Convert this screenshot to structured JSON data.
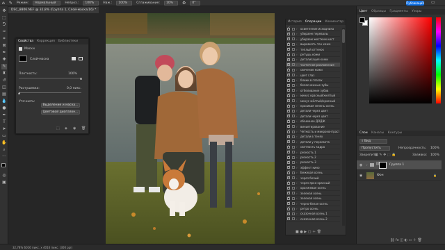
{
  "options_bar": {
    "mode_label": "Режим:",
    "mode_value": "Нормальный",
    "opacity_label": "Непроз.:",
    "opacity_value": "100%",
    "pressure_label": "Наж.:",
    "pressure_value": "100%",
    "smoothing_label": "Сглаживание:",
    "smoothing_value": "10%",
    "angle_value": "0°",
    "publish_label": "Публикация"
  },
  "document_tab": "DSC_8806.NEF @ 32,8% (Группа 1, Слой-маска/16) *",
  "status_bar": "32,78%   6016 пикс. x 4016 пикс. (300 ppi)",
  "properties_panel": {
    "tabs": [
      "Свойства",
      "Коррекция",
      "Библиотеки"
    ],
    "section_label": "Маски",
    "mask_name": "Слой-маска",
    "density_label": "Плотность:",
    "density_value": "100%",
    "feather_label": "Растушевка:",
    "feather_value": "0,0 пикс.",
    "refine_label": "Уточнить:",
    "select_mask_button": "Выделение и маска...",
    "color_range_button": "Цветовой диапазон..."
  },
  "history_panel": {
    "tabs": [
      "История",
      "Операции",
      "Комментар"
    ],
    "items": [
      "осветление исходника",
      "убираем перевалы",
      "убираем жестким кист",
      "выровнять тон коже",
      "теплый оттенок",
      "ретушь кожи",
      "детализация кожи",
      "частотное разложение",
      "свечение кожи",
      "цвет глаз",
      "блики в глазах",
      "белоснежные зубы",
      "отбеливание зубов",
      "минус красный/желтый",
      "минус жёлтый/красный",
      "красивая зелень осень",
      "детали через цвет",
      "детали через цвет",
      "объемное ДОДЖ",
      "виньетирование",
      "Четкость и микроконтраст",
      "детали в тенях",
      "детали у пересвета",
      "светлость кадра",
      "резкость 1",
      "резкость 2",
      "резкость 3",
      "эффект кино",
      "Бежевая осень",
      "через белый",
      "через ярко-красный",
      "оранжевая осень",
      "зеленая осень",
      "зеленая осень",
      "черно-белая осень",
      "ретро осень",
      "сказочная осень 1",
      "сказочная осень 2"
    ],
    "selected_index": 7
  },
  "color_panel": {
    "tabs": [
      "Цвет",
      "Образцы",
      "Градиенты",
      "Узоры"
    ],
    "hue_color": "#ff0000"
  },
  "layers_panel": {
    "tabs": [
      "Слои",
      "Каналы",
      "Контуры"
    ],
    "kind_label": "Вид",
    "blend_mode": "Пропустить",
    "opacity_label": "Непрозрачность:",
    "opacity_value": "100%",
    "lock_label": "Закрепить:",
    "fill_label": "Заливка:",
    "fill_value": "100%",
    "layers": [
      {
        "name": "Группа 1",
        "type": "group"
      },
      {
        "name": "Фон",
        "type": "image"
      }
    ]
  }
}
